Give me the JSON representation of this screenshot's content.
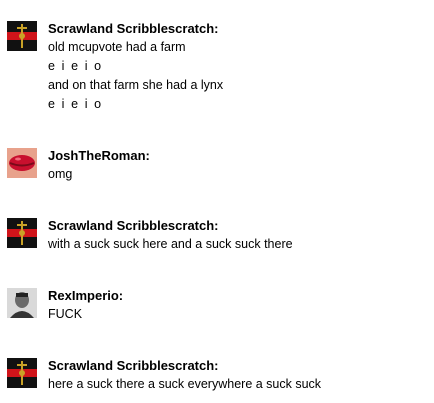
{
  "messages": [
    {
      "author": "Scrawland Scribblescratch:",
      "avatar_icon": "red-black-flag-avatar",
      "lines": [
        "old mcupvote had a farm",
        "e i e i o",
        "and on that farm she had a lynx",
        "e i e i o"
      ]
    },
    {
      "author": "JoshTheRoman:",
      "avatar_icon": "red-lips-avatar",
      "lines": [
        "omg"
      ]
    },
    {
      "author": "Scrawland Scribblescratch:",
      "avatar_icon": "red-black-flag-avatar",
      "lines": [
        "with a suck suck here and a suck suck there"
      ]
    },
    {
      "author": "RexImperio:",
      "avatar_icon": "portrait-photo-avatar",
      "lines": [
        "FUCK"
      ]
    },
    {
      "author": "Scrawland Scribblescratch:",
      "avatar_icon": "red-black-flag-avatar",
      "lines": [
        "here a suck there a suck everywhere a suck suck"
      ]
    }
  ]
}
